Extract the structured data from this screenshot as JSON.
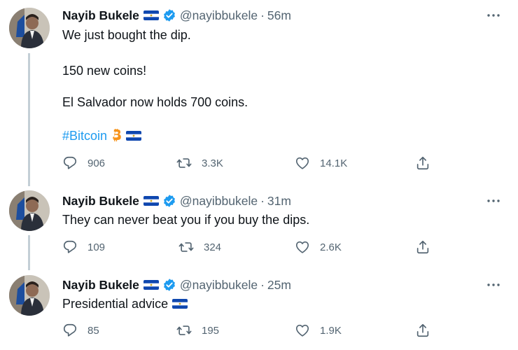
{
  "tweets": [
    {
      "name": "Nayib Bukele",
      "handle": "@nayibbukele",
      "dot": "·",
      "time": "56m",
      "lines": [
        "We just bought the dip.",
        "150 new coins!",
        "El Salvador now holds 700 coins."
      ],
      "hashtag": "#Bitcoin",
      "replies": "906",
      "retweets": "3.3K",
      "likes": "14.1K"
    },
    {
      "name": "Nayib Bukele",
      "handle": "@nayibbukele",
      "dot": "·",
      "time": "31m",
      "lines": [
        "They can never beat you if you buy the dips."
      ],
      "replies": "109",
      "retweets": "324",
      "likes": "2.6K"
    },
    {
      "name": "Nayib Bukele",
      "handle": "@nayibbukele",
      "dot": "·",
      "time": "25m",
      "lines": [
        "Presidential advice"
      ],
      "replies": "85",
      "retweets": "195",
      "likes": "1.9K"
    }
  ],
  "colors": {
    "accent": "#1d9bf0",
    "muted": "#536471",
    "text": "#0f1419",
    "flag_blue": "#0f47af",
    "bitcoin": "#f7931a"
  },
  "icons": [
    "reply-icon",
    "retweet-icon",
    "like-icon",
    "share-icon",
    "more-icon",
    "verified-icon",
    "el-salvador-flag-icon",
    "bitcoin-icon"
  ]
}
